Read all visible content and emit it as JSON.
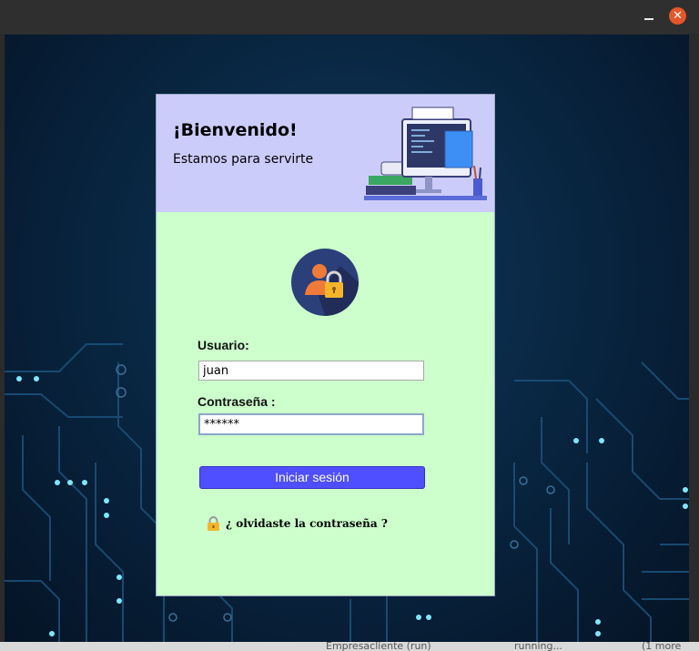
{
  "window": {
    "close_glyph": "✕"
  },
  "header": {
    "welcome": "¡Bienvenido!",
    "tagline": "Estamos para servirte",
    "illustration_icon": "computer-desk-illustration"
  },
  "form": {
    "avatar_icon": "user-lock-icon",
    "user_label": "Usuario:",
    "user_value": "juan",
    "password_label": "Contraseña :",
    "password_value": "******",
    "login_label": "Iniciar sesión",
    "forgot_icon": "lock-icon",
    "forgot_label": "¿ olvidaste la contraseña ?"
  },
  "taskbar": {
    "item1": "Empresacliente (run)",
    "item2": "running...",
    "item3": "(1 more"
  },
  "colors": {
    "header_bg": "#ccccfa",
    "panel_bg": "#ccffcc",
    "button_bg": "#4f4fff",
    "close_button": "#e6562b",
    "background_dark": "#061a30",
    "circuit_light": "#7fe6ff"
  }
}
